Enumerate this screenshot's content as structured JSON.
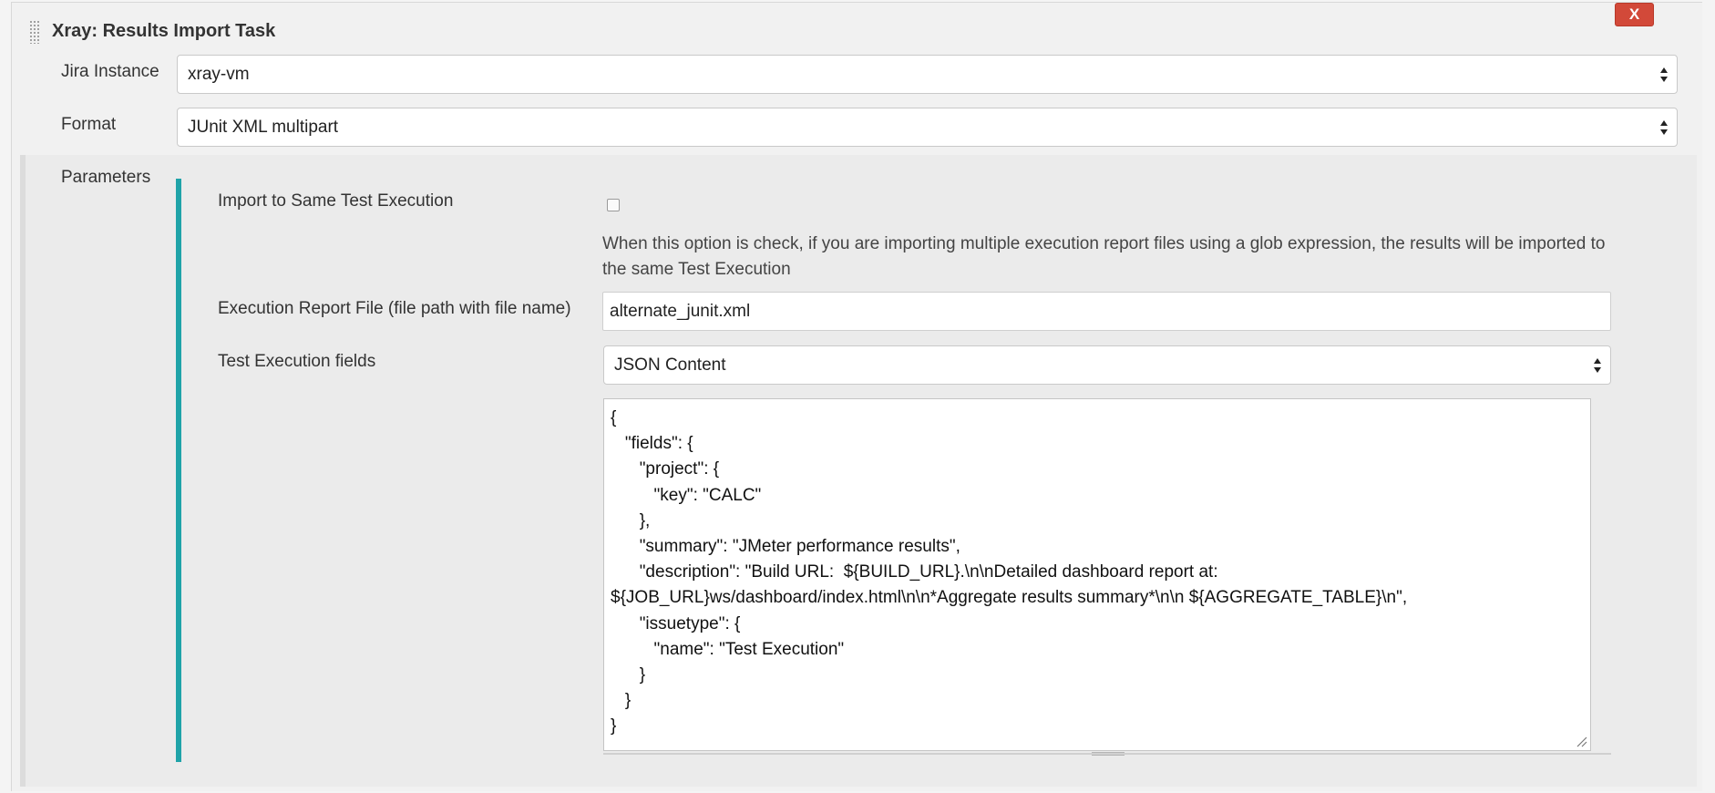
{
  "task": {
    "title": "Xray: Results Import Task",
    "close_label": "X"
  },
  "jira_instance": {
    "label": "Jira Instance",
    "value": "xray-vm"
  },
  "format": {
    "label": "Format",
    "value": "JUnit XML multipart"
  },
  "parameters": {
    "label": "Parameters",
    "import_same_execution": {
      "label": "Import to Same Test Execution",
      "checked": false,
      "help": "When this option is check, if you are importing multiple execution report files using a glob expression, the results will be imported to the same Test Execution"
    },
    "report_file": {
      "label": "Execution Report File (file path with file name)",
      "value": "alternate_junit.xml"
    },
    "test_execution_fields": {
      "label": "Test Execution fields",
      "value": "JSON Content",
      "json_content": "{\n   \"fields\": {\n      \"project\": {\n         \"key\": \"CALC\"\n      },\n      \"summary\": \"JMeter performance results\",\n      \"description\": \"Build URL:  ${BUILD_URL}.\\n\\nDetailed dashboard report at: ${JOB_URL}ws/dashboard/index.html\\n\\n*Aggregate results summary*\\n\\n ${AGGREGATE_TABLE}\\n\",\n      \"issuetype\": {\n         \"name\": \"Test Execution\"\n      }\n   }\n}"
    }
  },
  "colors": {
    "accent_bar": "#1fa3a8",
    "close_button": "#d24939"
  }
}
